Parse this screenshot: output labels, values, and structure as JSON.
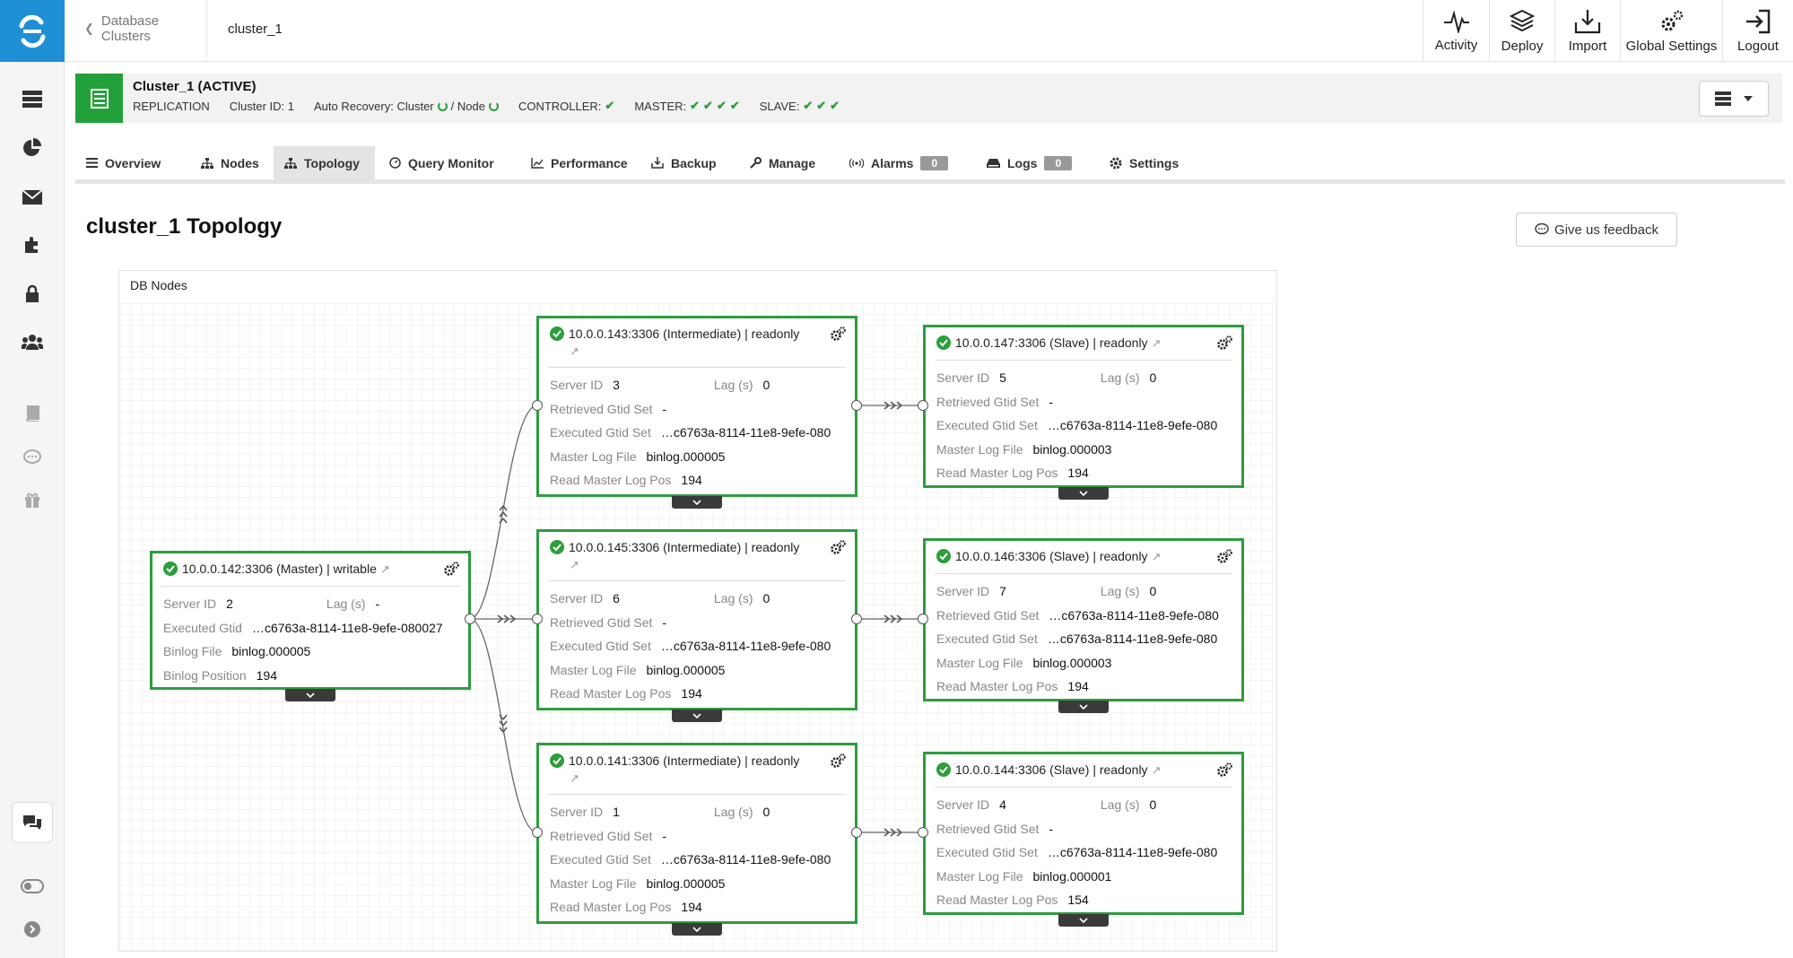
{
  "breadcrumb": {
    "parent": "Database Clusters",
    "current": "cluster_1"
  },
  "topbar": {
    "activity": "Activity",
    "deploy": "Deploy",
    "import": "Import",
    "global_settings": "Global Settings",
    "logout": "Logout"
  },
  "cluster": {
    "title": "Cluster_1 (ACTIVE)",
    "type": "REPLICATION",
    "cluster_id": "Cluster ID: 1",
    "auto_recovery_label": "Auto Recovery: Cluster",
    "auto_recovery_node": "/ Node",
    "controller_label": "CONTROLLER:",
    "master_label": "MASTER:",
    "slave_label": "SLAVE:"
  },
  "tabs": [
    {
      "label": "Overview"
    },
    {
      "label": "Nodes"
    },
    {
      "label": "Topology"
    },
    {
      "label": "Query Monitor"
    },
    {
      "label": "Performance"
    },
    {
      "label": "Backup"
    },
    {
      "label": "Manage"
    },
    {
      "label": "Alarms",
      "badge": "0"
    },
    {
      "label": "Logs",
      "badge": "0"
    },
    {
      "label": "Settings"
    }
  ],
  "page": {
    "title": "cluster_1 Topology",
    "feedback": "Give us feedback",
    "panel_title": "DB Nodes"
  },
  "labels": {
    "server_id": "Server ID",
    "lag": "Lag (s)",
    "executed_gtid": "Executed Gtid",
    "binlog_file": "Binlog File",
    "binlog_position": "Binlog Position",
    "retrieved_gtid_set": "Retrieved Gtid Set",
    "executed_gtid_set": "Executed Gtid Set",
    "master_log_file": "Master Log File",
    "read_master_log_pos": "Read Master Log Pos"
  },
  "nodes": {
    "master": {
      "title": "10.0.0.142:3306 (Master) | writable",
      "server_id": "2",
      "lag": "-",
      "executed_gtid": "…c6763a-8114-11e8-9efe-080027",
      "binlog_file": "binlog.000005",
      "binlog_position": "194"
    },
    "int143": {
      "title": "10.0.0.143:3306 (Intermediate) | readonly",
      "server_id": "3",
      "lag": "0",
      "retrieved": "-",
      "executed": "…c6763a-8114-11e8-9efe-080",
      "master_log_file": "binlog.000005",
      "read_pos": "194"
    },
    "int145": {
      "title": "10.0.0.145:3306 (Intermediate) | readonly",
      "server_id": "6",
      "lag": "0",
      "retrieved": "-",
      "executed": "…c6763a-8114-11e8-9efe-080",
      "master_log_file": "binlog.000005",
      "read_pos": "194"
    },
    "int141": {
      "title": "10.0.0.141:3306 (Intermediate) | readonly",
      "server_id": "1",
      "lag": "0",
      "retrieved": "-",
      "executed": "…c6763a-8114-11e8-9efe-080",
      "master_log_file": "binlog.000005",
      "read_pos": "194"
    },
    "slave147": {
      "title": "10.0.0.147:3306 (Slave) | readonly",
      "server_id": "5",
      "lag": "0",
      "retrieved": "-",
      "executed": "…c6763a-8114-11e8-9efe-080",
      "master_log_file": "binlog.000003",
      "read_pos": "194"
    },
    "slave146": {
      "title": "10.0.0.146:3306 (Slave) | readonly",
      "server_id": "7",
      "lag": "0",
      "retrieved": "…c6763a-8114-11e8-9efe-080",
      "executed": "…c6763a-8114-11e8-9efe-080",
      "master_log_file": "binlog.000003",
      "read_pos": "194"
    },
    "slave144": {
      "title": "10.0.0.144:3306 (Slave) | readonly",
      "server_id": "4",
      "lag": "0",
      "retrieved": "-",
      "executed": "…c6763a-8114-11e8-9efe-080",
      "master_log_file": "binlog.000001",
      "read_pos": "154"
    }
  },
  "colors": {
    "brand": "#1f8fd6",
    "ok": "#2c9e3b",
    "node_border": "#2e9c3e"
  }
}
